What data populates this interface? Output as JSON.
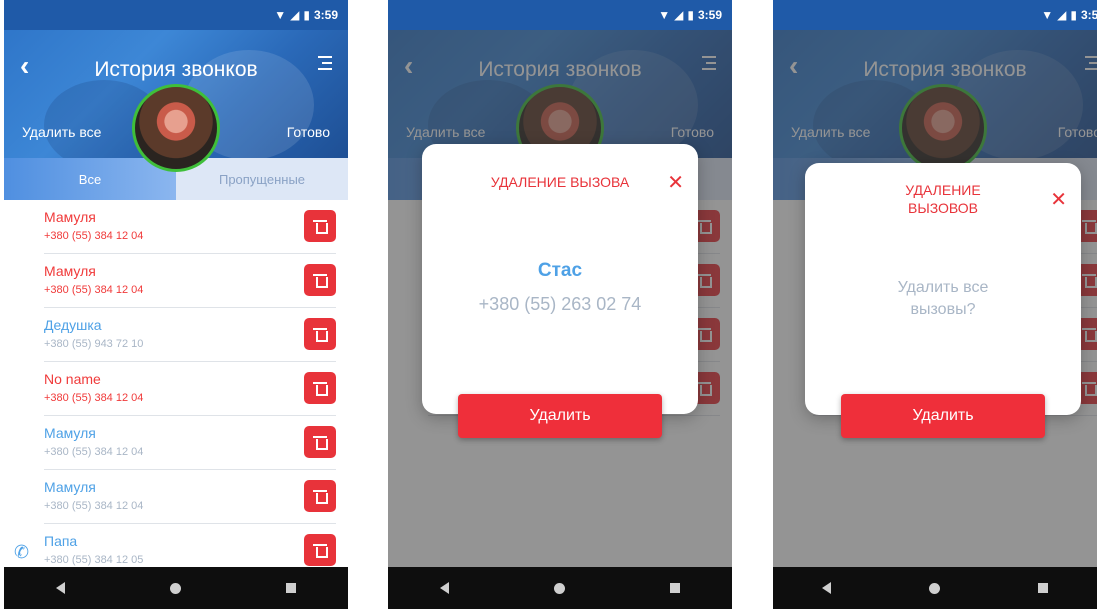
{
  "status": {
    "time": "3:59"
  },
  "header": {
    "title": "История звонков",
    "delete_all": "Удалить все",
    "done": "Готово"
  },
  "tabs": {
    "all": "Все",
    "missed": "Пропущенные"
  },
  "calls": [
    {
      "name": "Мамуля",
      "phone": "+380 (55) 384 12 04",
      "color": "red"
    },
    {
      "name": "Мамуля",
      "phone": "+380 (55) 384 12 04",
      "color": "red"
    },
    {
      "name": "Дедушка",
      "phone": "+380 (55) 943 72 10",
      "color": "blue"
    },
    {
      "name": "No name",
      "phone": "+380 (55) 384 12 04",
      "color": "red"
    },
    {
      "name": "Мамуля",
      "phone": "+380 (55) 384 12 04",
      "color": "blue"
    },
    {
      "name": "Мамуля",
      "phone": "+380 (55) 384 12 04",
      "color": "blue"
    },
    {
      "name": "Папа",
      "phone": "+380 (55) 384 12 05",
      "color": "blue"
    }
  ],
  "dialog_single": {
    "title": "УДАЛЕНИЕ ВЫЗОВА",
    "name": "Стас",
    "phone": "+380 (55) 263 02 74",
    "button": "Удалить"
  },
  "dialog_all": {
    "title_line1": "УДАЛЕНИЕ",
    "title_line2": "ВЫЗОВОВ",
    "message_line1": "Удалить все",
    "message_line2": "вызовы?",
    "button": "Удалить"
  },
  "colors": {
    "accent_red": "#e8333a",
    "accent_blue": "#4ea1e6",
    "header_blue": "#2f76c9",
    "avatar_ring": "#3fbf3a"
  }
}
